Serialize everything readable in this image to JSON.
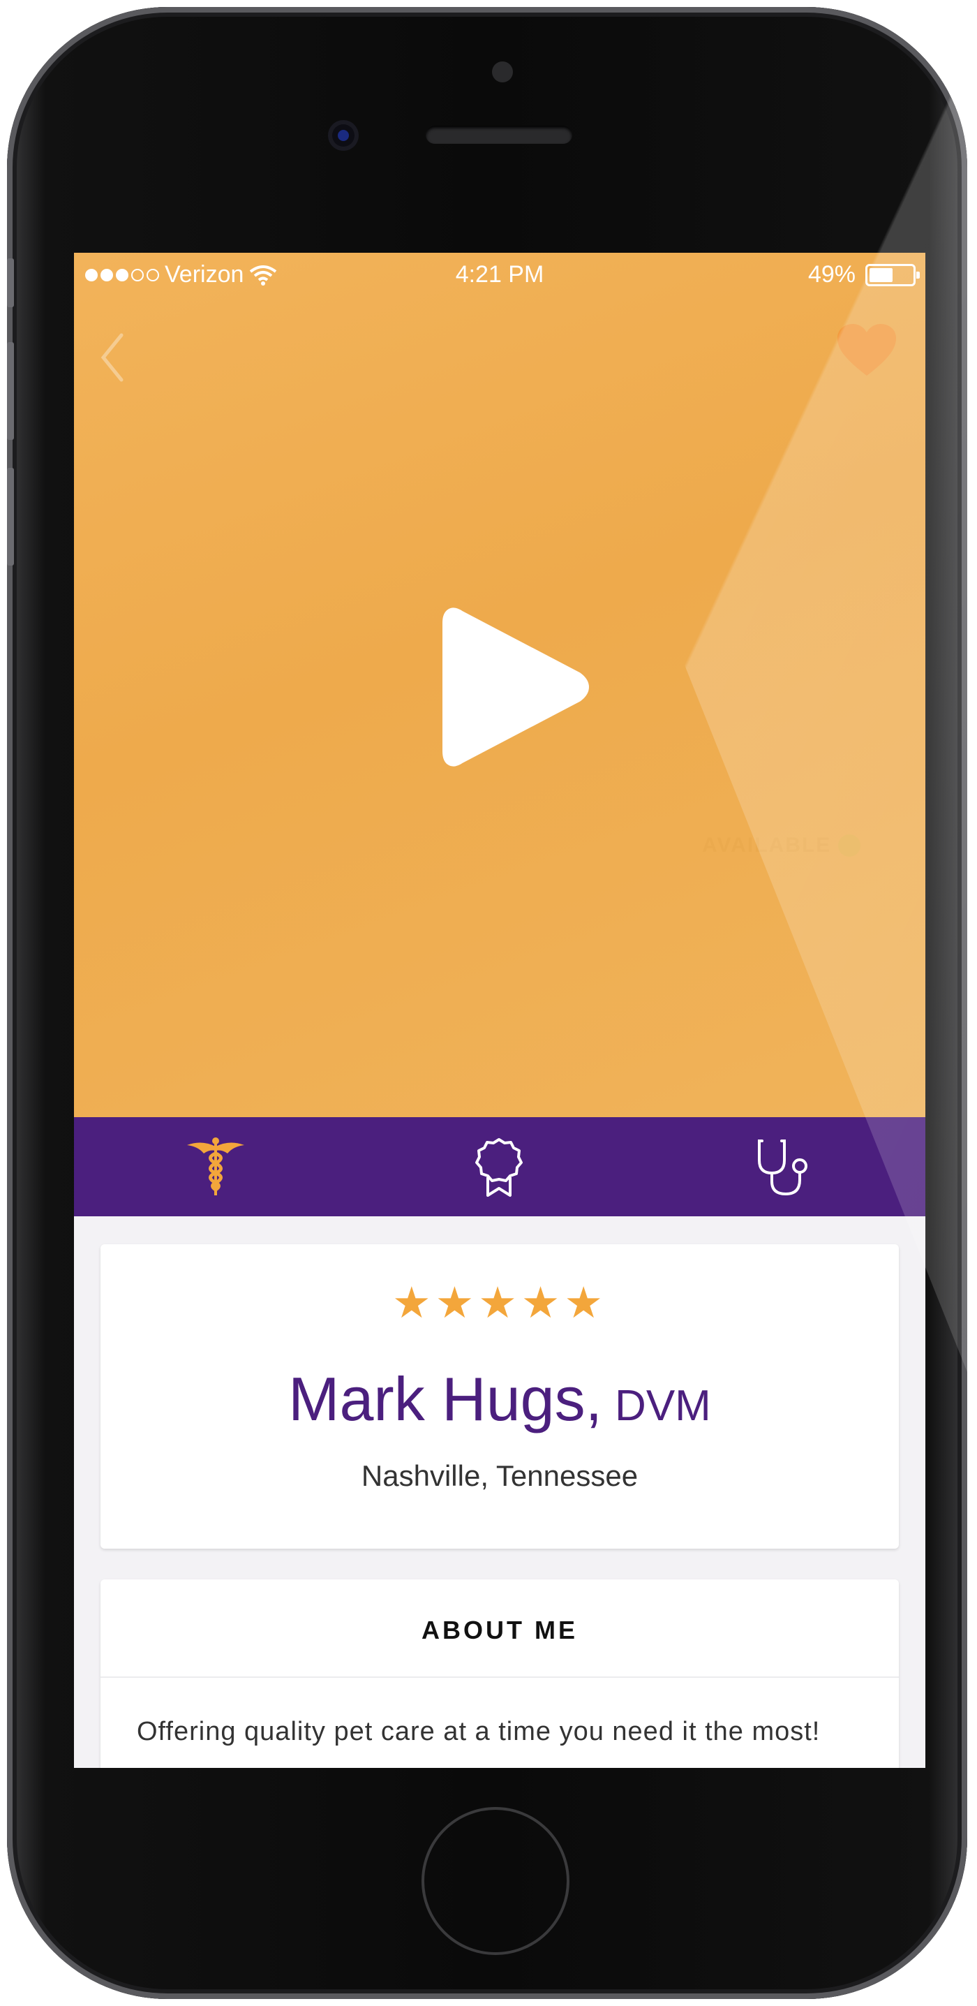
{
  "status_bar": {
    "carrier": "Verizon",
    "time": "4:21 PM",
    "battery": "49%"
  },
  "video": {
    "availability": "AVAILABLE"
  },
  "tabs": [
    {
      "icon": "caduceus-icon",
      "active": true
    },
    {
      "icon": "award-ribbon-icon",
      "active": false
    },
    {
      "icon": "stethoscope-icon",
      "active": false
    }
  ],
  "profile": {
    "rating_stars": "★★★★★",
    "rating": 5,
    "name": "Mark Hugs,",
    "credential": "DVM",
    "location": "Nashville, Tennessee"
  },
  "about": {
    "heading": "ABOUT ME",
    "text": "Offering quality pet care at a time you need it the most!"
  },
  "colors": {
    "hero": "#eeaa4c",
    "brand_purple": "#4b1f7e",
    "accent_gold": "#f3a63b",
    "favorite": "#f39a3e"
  }
}
